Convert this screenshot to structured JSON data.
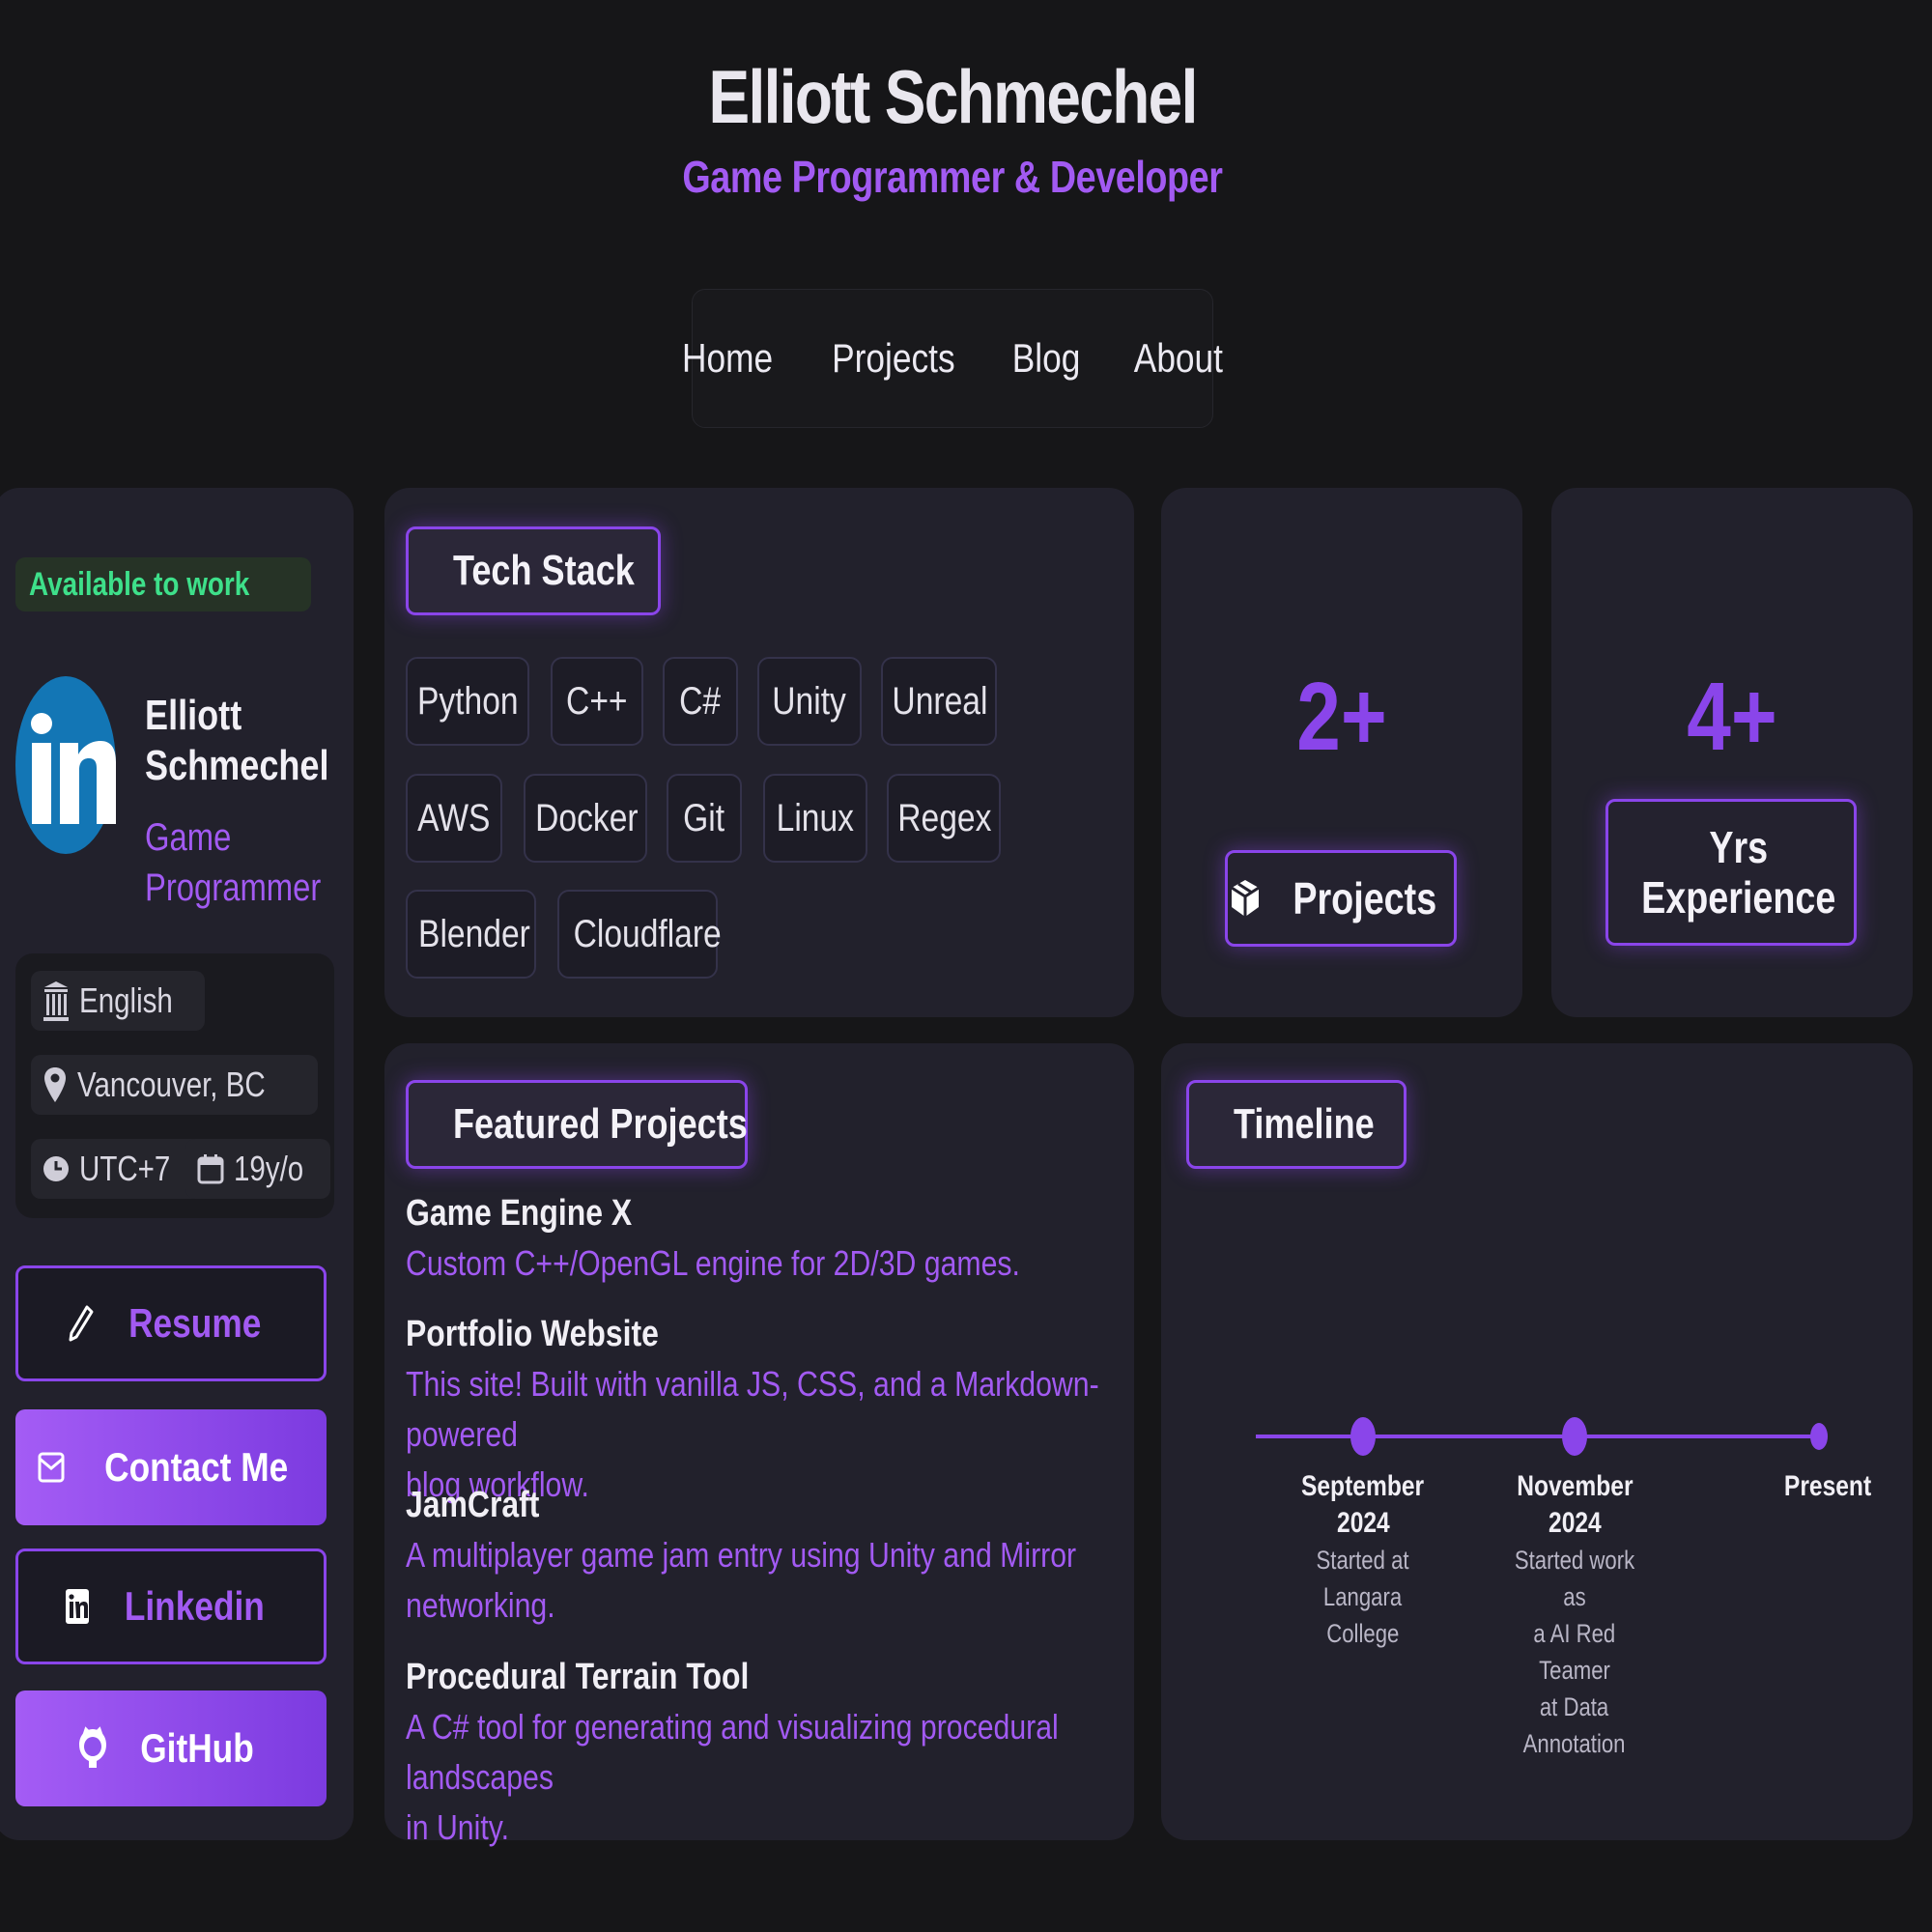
{
  "header": {
    "name": "Elliott Schmechel",
    "role": "Game Programmer & Developer"
  },
  "nav": [
    "Home",
    "Projects",
    "Blog",
    "About"
  ],
  "profile": {
    "status": "Available to work",
    "name_line1": "Elliott",
    "name_line2": "Schmechel",
    "role_line1": "Game",
    "role_line2": "Programmer",
    "language": "English",
    "location": "Vancouver, BC",
    "timezone": "UTC+7",
    "age": "19y/o",
    "buttons": {
      "resume": "Resume",
      "contact": "Contact Me",
      "linkedin": "Linkedin",
      "github": "GitHub"
    }
  },
  "tech": {
    "title": "Tech Stack",
    "items": [
      "Python",
      "C++",
      "C#",
      "Unity",
      "Unreal",
      "AWS",
      "Docker",
      "Git",
      "Linux",
      "Regex",
      "Blender",
      "Cloudflare"
    ]
  },
  "stats": {
    "projects_value": "2+",
    "projects_label": "Projects",
    "years_value": "4+",
    "years_label_line1": "Yrs",
    "years_label_line2": "Experience"
  },
  "featured": {
    "title": "Featured Projects",
    "projects": [
      {
        "title": "Game Engine X",
        "desc1": "Custom C++/OpenGL engine for 2D/3D games.",
        "desc2": ""
      },
      {
        "title": "Portfolio Website",
        "desc1": "This site! Built with vanilla JS, CSS, and a Markdown-powered",
        "desc2": "blog workflow."
      },
      {
        "title": "JamCraft",
        "desc1": "A multiplayer game jam entry using Unity and Mirror",
        "desc2": "networking."
      },
      {
        "title": "Procedural Terrain Tool",
        "desc1": "A C# tool for generating and visualizing procedural landscapes",
        "desc2": "in Unity."
      }
    ]
  },
  "timeline": {
    "title": "Timeline",
    "events": [
      {
        "date1": "September",
        "date2": "2024",
        "desc": [
          "Started at",
          "Langara",
          "College"
        ]
      },
      {
        "date1": "November",
        "date2": "2024",
        "desc": [
          "Started work as",
          "a AI Red",
          "Teamer",
          "at Data",
          "Annotation"
        ]
      },
      {
        "date1": "Present",
        "date2": "",
        "desc": []
      }
    ]
  },
  "colors": {
    "accent": "#8a45ea",
    "accent_text": "#a25af2",
    "available": "#3ee08a",
    "background": "#161618",
    "card": "#22212c"
  }
}
